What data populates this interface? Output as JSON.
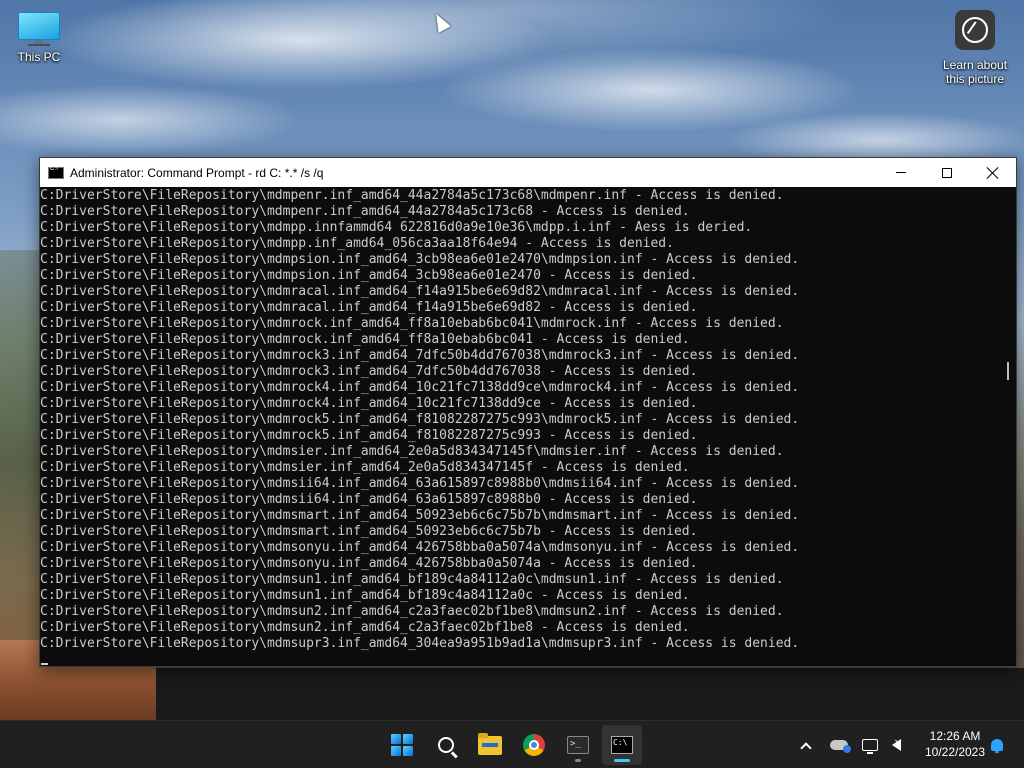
{
  "desktop": {
    "icons": [
      {
        "label": "This PC"
      },
      {
        "label_line1": "Learn about",
        "label_line2": "this picture"
      }
    ]
  },
  "console": {
    "title": "Administrator: Command Prompt - rd  C: *.* /s /q",
    "lines": [
      "C:DriverStore\\FileRepository\\mdmpenr.inf_amd64_44a2784a5c173c68\\mdmpenr.inf - Access is denied.",
      "C:DriverStore\\FileRepository\\mdmpenr.inf_amd64_44a2784a5c173c68 - Access is denied.",
      "C:DriverStore\\FileRepository\\mdmpp.innfammd64 622816d0a9e10e36\\mdpp.i.inf - Aess is deried.",
      "C:DriverStore\\FileRepository\\mdmpp.inf_amd64_056ca3aa18f64e94 - Access is denied.",
      "C:DriverStore\\FileRepository\\mdmpsion.inf_amd64_3cb98ea6e01e2470\\mdmpsion.inf - Access is denied.",
      "C:DriverStore\\FileRepository\\mdmpsion.inf_amd64_3cb98ea6e01e2470 - Access is denied.",
      "C:DriverStore\\FileRepository\\mdmracal.inf_amd64_f14a915be6e69d82\\mdmracal.inf - Access is denied.",
      "C:DriverStore\\FileRepository\\mdmracal.inf_amd64_f14a915be6e69d82 - Access is denied.",
      "C:DriverStore\\FileRepository\\mdmrock.inf_amd64_ff8a10ebab6bc041\\mdmrock.inf - Access is denied.",
      "C:DriverStore\\FileRepository\\mdmrock.inf_amd64_ff8a10ebab6bc041 - Access is denied.",
      "C:DriverStore\\FileRepository\\mdmrock3.inf_amd64_7dfc50b4dd767038\\mdmrock3.inf - Access is denied.",
      "C:DriverStore\\FileRepository\\mdmrock3.inf_amd64_7dfc50b4dd767038 - Access is denied.",
      "C:DriverStore\\FileRepository\\mdmrock4.inf_amd64_10c21fc7138dd9ce\\mdmrock4.inf - Access is denied.",
      "C:DriverStore\\FileRepository\\mdmrock4.inf_amd64_10c21fc7138dd9ce - Access is denied.",
      "C:DriverStore\\FileRepository\\mdmrock5.inf_amd64_f81082287275c993\\mdmrock5.inf - Access is denied.",
      "C:DriverStore\\FileRepository\\mdmrock5.inf_amd64_f81082287275c993 - Access is denied.",
      "C:DriverStore\\FileRepository\\mdmsier.inf_amd64_2e0a5d834347145f\\mdmsier.inf - Access is denied.",
      "C:DriverStore\\FileRepository\\mdmsier.inf_amd64_2e0a5d834347145f - Access is denied.",
      "C:DriverStore\\FileRepository\\mdmsii64.inf_amd64_63a615897c8988b0\\mdmsii64.inf - Access is denied.",
      "C:DriverStore\\FileRepository\\mdmsii64.inf_amd64_63a615897c8988b0 - Access is denied.",
      "C:DriverStore\\FileRepository\\mdmsmart.inf_amd64_50923eb6c6c75b7b\\mdmsmart.inf - Access is denied.",
      "C:DriverStore\\FileRepository\\mdmsmart.inf_amd64_50923eb6c6c75b7b - Access is denied.",
      "C:DriverStore\\FileRepository\\mdmsonyu.inf_amd64_426758bba0a5074a\\mdmsonyu.inf - Access is denied.",
      "C:DriverStore\\FileRepository\\mdmsonyu.inf_amd64_426758bba0a5074a - Access is denied.",
      "C:DriverStore\\FileRepository\\mdmsun1.inf_amd64_bf189c4a84112a0c\\mdmsun1.inf - Access is denied.",
      "C:DriverStore\\FileRepository\\mdmsun1.inf_amd64_bf189c4a84112a0c - Access is denied.",
      "C:DriverStore\\FileRepository\\mdmsun2.inf_amd64_c2a3faec02bf1be8\\mdmsun2.inf - Access is denied.",
      "C:DriverStore\\FileRepository\\mdmsun2.inf_amd64_c2a3faec02bf1be8 - Access is denied.",
      "C:DriverStore\\FileRepository\\mdmsupr3.inf_amd64_304ea9a951b9ad1a\\mdmsupr3.inf - Access is denied."
    ]
  },
  "taskbar": {
    "apps": [
      {
        "icon": "windows-start-icon"
      },
      {
        "icon": "search-icon"
      },
      {
        "icon": "file-explorer-icon"
      },
      {
        "icon": "chrome-icon"
      },
      {
        "icon": "terminal-icon"
      },
      {
        "icon": "command-prompt-icon",
        "active": true
      }
    ],
    "accent": "#4cc2ff",
    "clock": {
      "time": "12:26 AM",
      "date": "10/22/2023"
    }
  }
}
